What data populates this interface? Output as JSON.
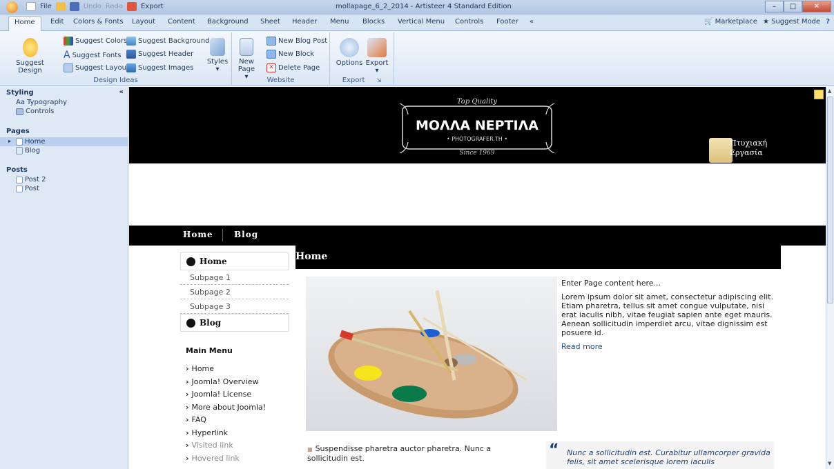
{
  "window": {
    "title": "mollapage_6_2_2014 - Artisteer 4 Standard Edition",
    "qat": {
      "file": "File",
      "undo": "Undo",
      "redo": "Redo",
      "export": "Export"
    }
  },
  "ribbon_tabs": [
    "Home",
    "Edit",
    "Colors & Fonts",
    "Layout",
    "Content",
    "Background",
    "Sheet",
    "Header",
    "Menu",
    "Blocks",
    "Vertical Menu",
    "Controls",
    "Footer",
    "«"
  ],
  "ribbon_right": {
    "marketplace": "Marketplace",
    "suggest_mode": "Suggest Mode"
  },
  "design_ideas": {
    "label": "Design Ideas",
    "suggest_design": "Suggest Design",
    "suggest_colors": "Suggest Colors",
    "suggest_fonts": "Suggest Fonts",
    "suggest_layout": "Suggest Layout",
    "suggest_background": "Suggest Background",
    "suggest_header": "Suggest Header",
    "suggest_images": "Suggest Images",
    "styles": "Styles"
  },
  "website": {
    "label": "Website",
    "new_page": "New",
    "new_page2": "Page",
    "new_blog_post": "New Blog Post",
    "new_block": "New Block",
    "delete_page": "Delete Page"
  },
  "export_group": {
    "label": "Export",
    "options": "Options",
    "export": "Export"
  },
  "left_panel": {
    "styling": "Styling",
    "collapse": "«",
    "typography": "Typography",
    "controls": "Controls",
    "pages": "Pages",
    "page_home": "Home",
    "page_blog": "Blog",
    "posts": "Posts",
    "post2": "Post 2",
    "post": "Post"
  },
  "site": {
    "logo_top": "Top Quality",
    "logo_main": "ΜΟΛΛΑ ΝΕΡΤΙΛΑ",
    "logo_sub": "• PHOTOGRAFER.TH •",
    "logo_since": "Since 1969",
    "badge_line1": "Πτυχιακή",
    "badge_line2": "Εργασία",
    "nav_home": "Home",
    "nav_blog": "Blog",
    "vmenu_home": "Home",
    "vmenu_subs": [
      "Subpage 1",
      "Subpage 2",
      "Subpage 3"
    ],
    "vmenu_blog": "Blog",
    "main_menu_title": "Main Menu",
    "main_menu": [
      "Home",
      "Joomla! Overview",
      "Joomla! License",
      "More about Joomla!",
      "FAQ",
      "Hyperlink",
      "Visited link",
      "Hovered link"
    ],
    "page_heading": "Home",
    "intro": "Enter Page content here...",
    "lorem": "Lorem ipsum dolor sit amet, consectetur adipiscing elit. Etiam pharetra, tellus sit amet congue vulputate, nisi erat iaculis nibh, vitae feugiat sapien ante eget mauris. Aenean sollicitudin imperdiet arcu, vitae dignissim est posuere id.",
    "read_more": "Read more",
    "bullet1": "Suspendisse pharetra auctor pharetra. Nunc a sollicitudin est.",
    "quote": "Nunc a sollicitudin est. Curabitur ullamcorper gravida felis, sit amet scelerisque lorem iaculis"
  }
}
